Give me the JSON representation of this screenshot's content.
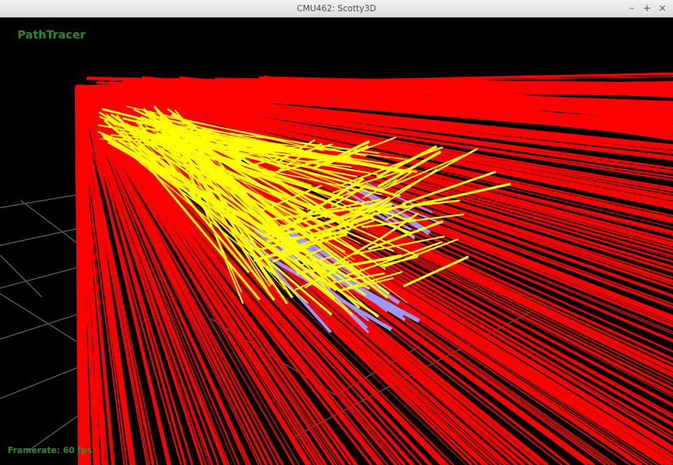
{
  "window": {
    "title": "CMU462: Scotty3D",
    "buttons": {
      "minimize": "–",
      "maximize": "+",
      "close": "×"
    }
  },
  "viewport": {
    "mode": "PathTracer",
    "framerate_label": "Framerate: 60 fps"
  },
  "colors": {
    "background": "#000000",
    "ray": "#ff0000",
    "shadow_ray": "#ffff00",
    "sphere": "#9999ff",
    "grid": "#5a5a5a",
    "hud_text": "#2e8b2e"
  }
}
